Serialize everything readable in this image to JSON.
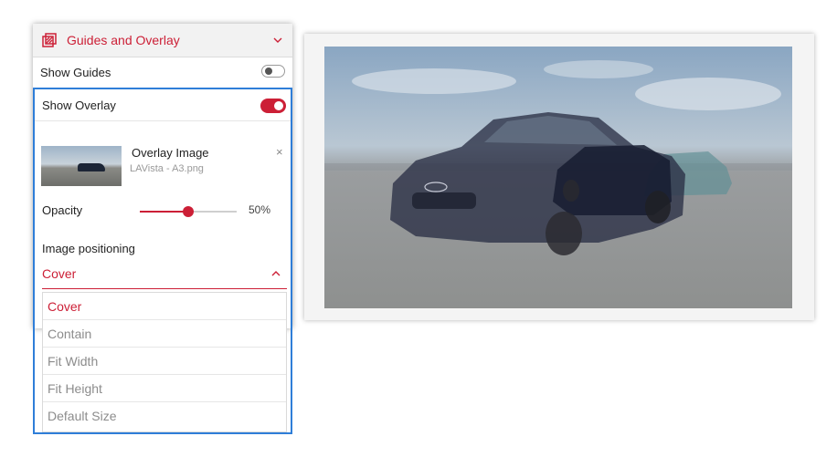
{
  "panel": {
    "title": "Guides and Overlay",
    "show_guides_label": "Show Guides",
    "show_guides_on": false,
    "show_overlay_label": "Show Overlay",
    "show_overlay_on": true,
    "overlay_image": {
      "title": "Overlay Image",
      "filename": "LAVista - A3.png",
      "remove_glyph": "×"
    },
    "opacity": {
      "label": "Opacity",
      "value_text": "50%",
      "value": 0.5
    },
    "image_positioning": {
      "label": "Image positioning",
      "selected": "Cover",
      "options": [
        "Cover",
        "Contain",
        "Fit Width",
        "Fit Height",
        "Default Size"
      ]
    }
  },
  "colors": {
    "accent": "#cc1f36",
    "selection_outline": "#2f7ed8"
  },
  "icons": {
    "header": "overlay-icon",
    "collapse": "chevron-down-icon",
    "select": "chevron-up-icon"
  }
}
